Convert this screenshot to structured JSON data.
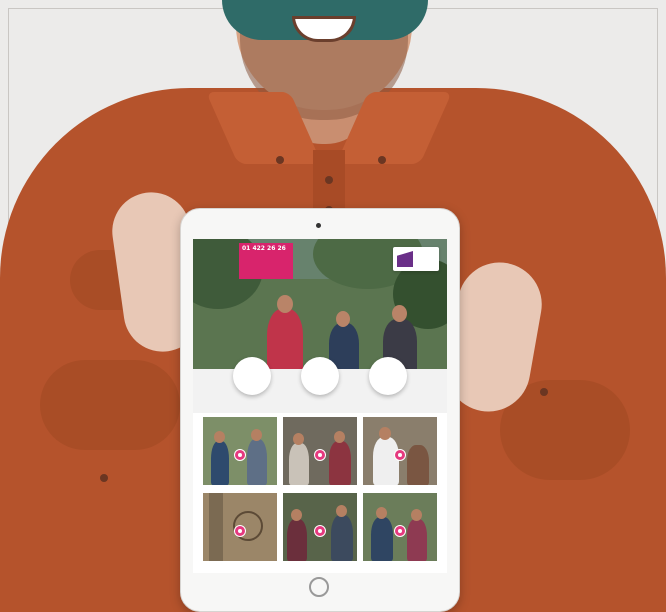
{
  "scene": {
    "description_free": true
  },
  "tablet": {
    "phone_number": "01 422 26 26",
    "phone_subtext": "",
    "hero_headline": "",
    "logo_text": "",
    "circles": [
      {
        "label": ""
      },
      {
        "label": ""
      },
      {
        "label": ""
      }
    ],
    "tiles": [
      {
        "label": ""
      },
      {
        "label": ""
      },
      {
        "label": ""
      },
      {
        "label": ""
      },
      {
        "label": ""
      },
      {
        "label": ""
      }
    ]
  },
  "colors": {
    "brand_pink": "#d8246c",
    "brand_purple": "#6a2f88",
    "shirt": "#b5532c",
    "background": "#ecebea"
  },
  "icons": [
    "heart-icon",
    "camera-icon",
    "home-button-icon"
  ]
}
